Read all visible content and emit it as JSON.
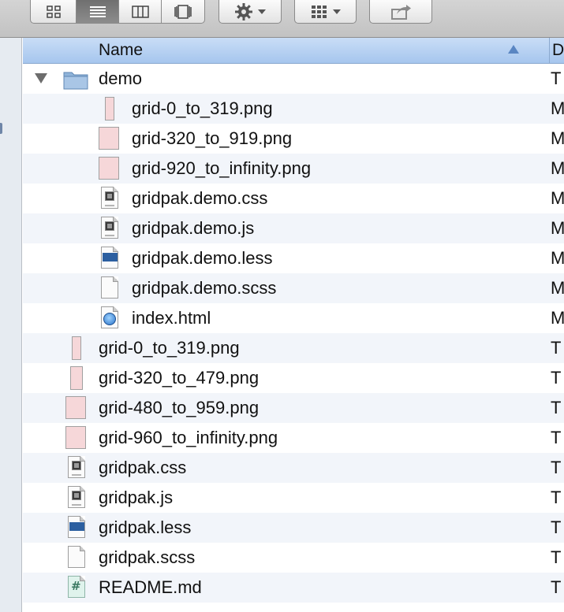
{
  "header": {
    "name_label": "Name",
    "second_column_label": "D"
  },
  "icons": {
    "toolbar": [
      "icon-view-icon",
      "list-view-icon",
      "column-view-icon",
      "coverflow-view-icon",
      "action-gear-icon",
      "arrange-icon",
      "share-icon"
    ],
    "file_types": [
      "folder-icon",
      "png-file-icon",
      "css-file-icon",
      "js-file-icon",
      "less-file-icon",
      "scss-file-icon",
      "html-file-icon",
      "markdown-file-icon"
    ]
  },
  "colors": {
    "header_blue": "#a6c6ee",
    "alt_row": "#f2f5fa",
    "png_thumb": "#f6d7d9"
  },
  "rows": [
    {
      "name": "demo",
      "col2": "T"
    },
    {
      "name": "grid-0_to_319.png",
      "col2": "M"
    },
    {
      "name": "grid-320_to_919.png",
      "col2": "M"
    },
    {
      "name": "grid-920_to_infinity.png",
      "col2": "M"
    },
    {
      "name": "gridpak.demo.css",
      "col2": "M"
    },
    {
      "name": "gridpak.demo.js",
      "col2": "M"
    },
    {
      "name": "gridpak.demo.less",
      "col2": "M"
    },
    {
      "name": "gridpak.demo.scss",
      "col2": "M"
    },
    {
      "name": "index.html",
      "col2": "M"
    },
    {
      "name": "grid-0_to_319.png",
      "col2": "T"
    },
    {
      "name": "grid-320_to_479.png",
      "col2": "T"
    },
    {
      "name": "grid-480_to_959.png",
      "col2": "T"
    },
    {
      "name": "grid-960_to_infinity.png",
      "col2": "T"
    },
    {
      "name": "gridpak.css",
      "col2": "T"
    },
    {
      "name": "gridpak.js",
      "col2": "T"
    },
    {
      "name": "gridpak.less",
      "col2": "T"
    },
    {
      "name": "gridpak.scss",
      "col2": "T"
    },
    {
      "name": "README.md",
      "col2": "T"
    }
  ]
}
